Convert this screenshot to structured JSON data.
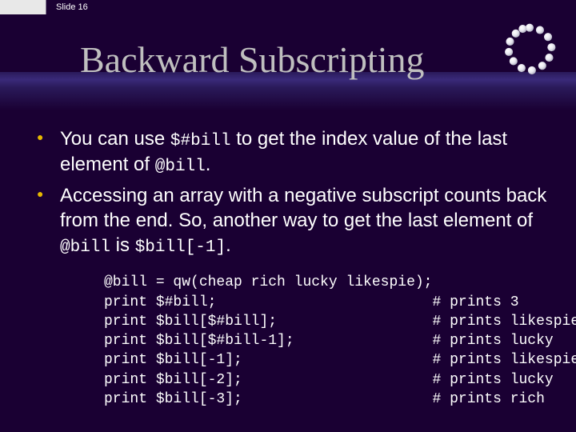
{
  "topbar": {
    "slide_label": "Slide 16"
  },
  "title": "Backward Subscripting",
  "bullets": [
    {
      "pre": "You can use ",
      "code1": "$#bill",
      "mid": " to get the index value of the last element of ",
      "code2": "@bill",
      "post": "."
    },
    {
      "pre": "Accessing an array with a negative subscript counts back from the end. So, another way to get the last element of ",
      "code1": "@bill",
      "mid": " is ",
      "code2": "$bill[-1]",
      "post": "."
    }
  ],
  "code": {
    "rows": [
      {
        "c1": "@bill",
        "c2": " = qw(cheap rich lucky likespie);",
        "c3": ""
      },
      {
        "c1": "print",
        "c2": " $#bill;          ",
        "c3": "# prints 3"
      },
      {
        "c1": "print",
        "c2": " $bill[$#bill];   ",
        "c3": "# prints likespie"
      },
      {
        "c1": "print",
        "c2": " $bill[$#bill-1]; ",
        "c3": "# prints lucky"
      },
      {
        "c1": "print",
        "c2": " $bill[-1];       ",
        "c3": "# prints likespie"
      },
      {
        "c1": "print",
        "c2": " $bill[-2];       ",
        "c3": "# prints lucky"
      },
      {
        "c1": "print",
        "c2": " $bill[-3];       ",
        "c3": "# prints rich"
      }
    ]
  }
}
